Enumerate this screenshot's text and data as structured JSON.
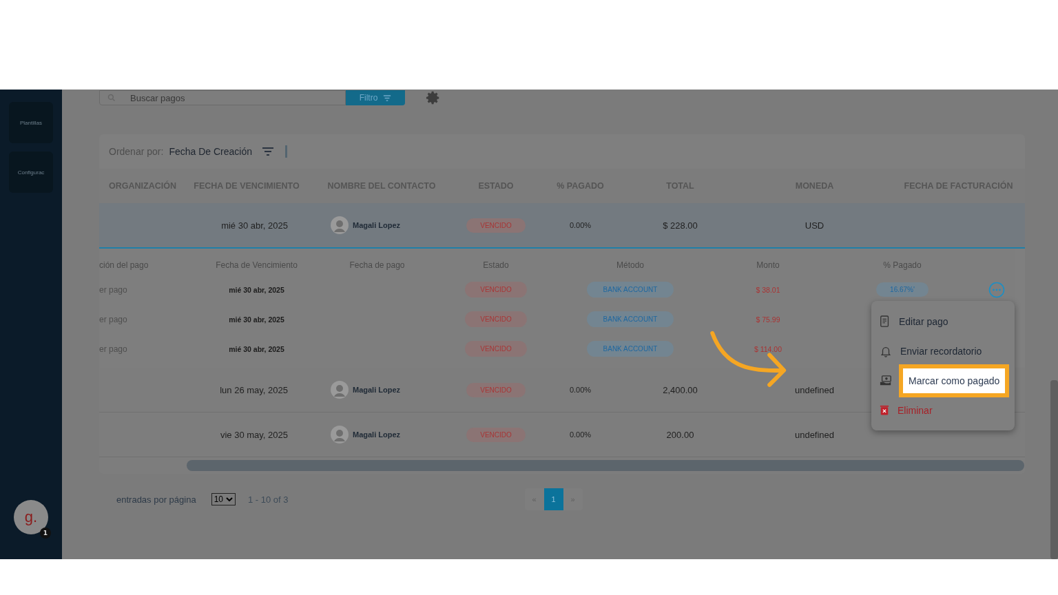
{
  "sidebar": {
    "items": [
      {
        "label": "Plantillas"
      },
      {
        "label": "Configurac"
      }
    ],
    "user": {
      "initial": "g.",
      "badge": "1"
    }
  },
  "toolbar": {
    "search": {
      "placeholder": "Buscar pagos"
    },
    "filter_button": "Filtro"
  },
  "sort": {
    "label": "Ordenar por:",
    "value": "Fecha De Creación"
  },
  "table": {
    "columns": [
      "ORGANIZACIÓN",
      "FECHA DE VENCIMIENTO",
      "NOMBRE DEL CONTACTO",
      "ESTADO",
      "% PAGADO",
      "TOTAL",
      "MONEDA",
      "FECHA DE FACTURACIÓN"
    ],
    "payment_columns": [
      "ción del pago",
      "Fecha de Vencimiento",
      "Fecha de pago",
      "Estado",
      "Método",
      "Monto",
      "% Pagado"
    ],
    "rows": [
      {
        "due": "mié 30 abr, 2025",
        "contact": "Magali Lopez",
        "status": "VENCIDO",
        "paid": "0.00%",
        "total": "$ 228.00",
        "currency": "USD",
        "expanded": true,
        "payments": [
          {
            "name": "er pago",
            "due": "mié 30 abr, 2025",
            "status": "VENCIDO",
            "method": "BANK ACCOUNT",
            "amount": "$ 38.01",
            "percent": "16.67%'",
            "actions": true
          },
          {
            "name": "er pago",
            "due": "mié 30 abr, 2025",
            "status": "VENCIDO",
            "method": "BANK ACCOUNT",
            "amount": "$ 75.99",
            "actions": false
          },
          {
            "name": "er pago",
            "due": "mié 30 abr, 2025",
            "status": "VENCIDO",
            "method": "BANK ACCOUNT",
            "amount": "$ 114.00",
            "actions": false
          }
        ]
      },
      {
        "due": "lun 26 may, 2025",
        "contact": "Magali Lopez",
        "status": "VENCIDO",
        "paid": "0.00%",
        "total": "2,400.00",
        "currency": "undefined",
        "expanded": false
      },
      {
        "due": "vie 30 may, 2025",
        "contact": "Magali Lopez",
        "status": "VENCIDO",
        "paid": "0.00%",
        "total": "200.00",
        "currency": "undefined",
        "expanded": false
      }
    ]
  },
  "menu": {
    "items": [
      {
        "kind": "edit",
        "label": "Editar pago",
        "highlighted": false
      },
      {
        "kind": "reminder",
        "label": "Enviar recordatorio",
        "highlighted": false
      },
      {
        "kind": "mark_paid",
        "label": "Marcar como pagado",
        "highlighted": true
      },
      {
        "kind": "delete",
        "label": "Eliminar",
        "highlighted": false
      }
    ]
  },
  "footer": {
    "per_page_label": "entradas por página",
    "per_page": "10",
    "range": "1 - 10 of 3",
    "pages": [
      {
        "label": "«",
        "selected": false
      },
      {
        "label": "1",
        "selected": true
      },
      {
        "label": "»",
        "selected": false
      }
    ]
  }
}
